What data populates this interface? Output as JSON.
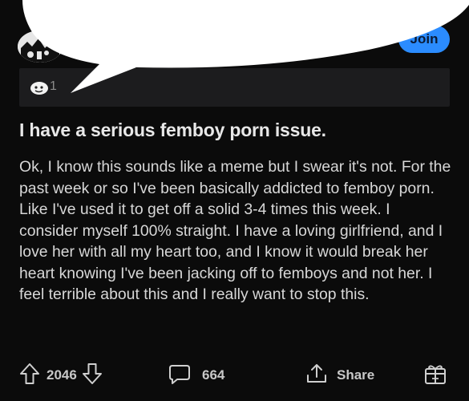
{
  "header": {
    "join_label": "Join"
  },
  "awards": {
    "count": "1",
    "icon": "award-icon"
  },
  "post": {
    "title": "I have a serious femboy porn issue.",
    "body": "Ok, I know this sounds like a meme but I swear it's not. For the past week or so I've been basically addicted to femboy porn. Like I've used it to get off a solid 3-4 times this week. I consider myself 100% straight. I have a loving girlfriend, and I love her with all my heart too, and I know it would break her heart knowing I've been jacking off to femboys and not her. I feel terrible about this and I really want to stop this."
  },
  "actions": {
    "votes": "2046",
    "comments": "664",
    "share_label": "Share",
    "icons": [
      "upvote-icon",
      "downvote-icon",
      "comment-icon",
      "share-icon",
      "give-award-icon"
    ]
  },
  "colors": {
    "background": "#0b0b0b",
    "join_button": "#2b8cff",
    "award_bar": "#1c1c1e",
    "text": "#d7d7d7"
  }
}
